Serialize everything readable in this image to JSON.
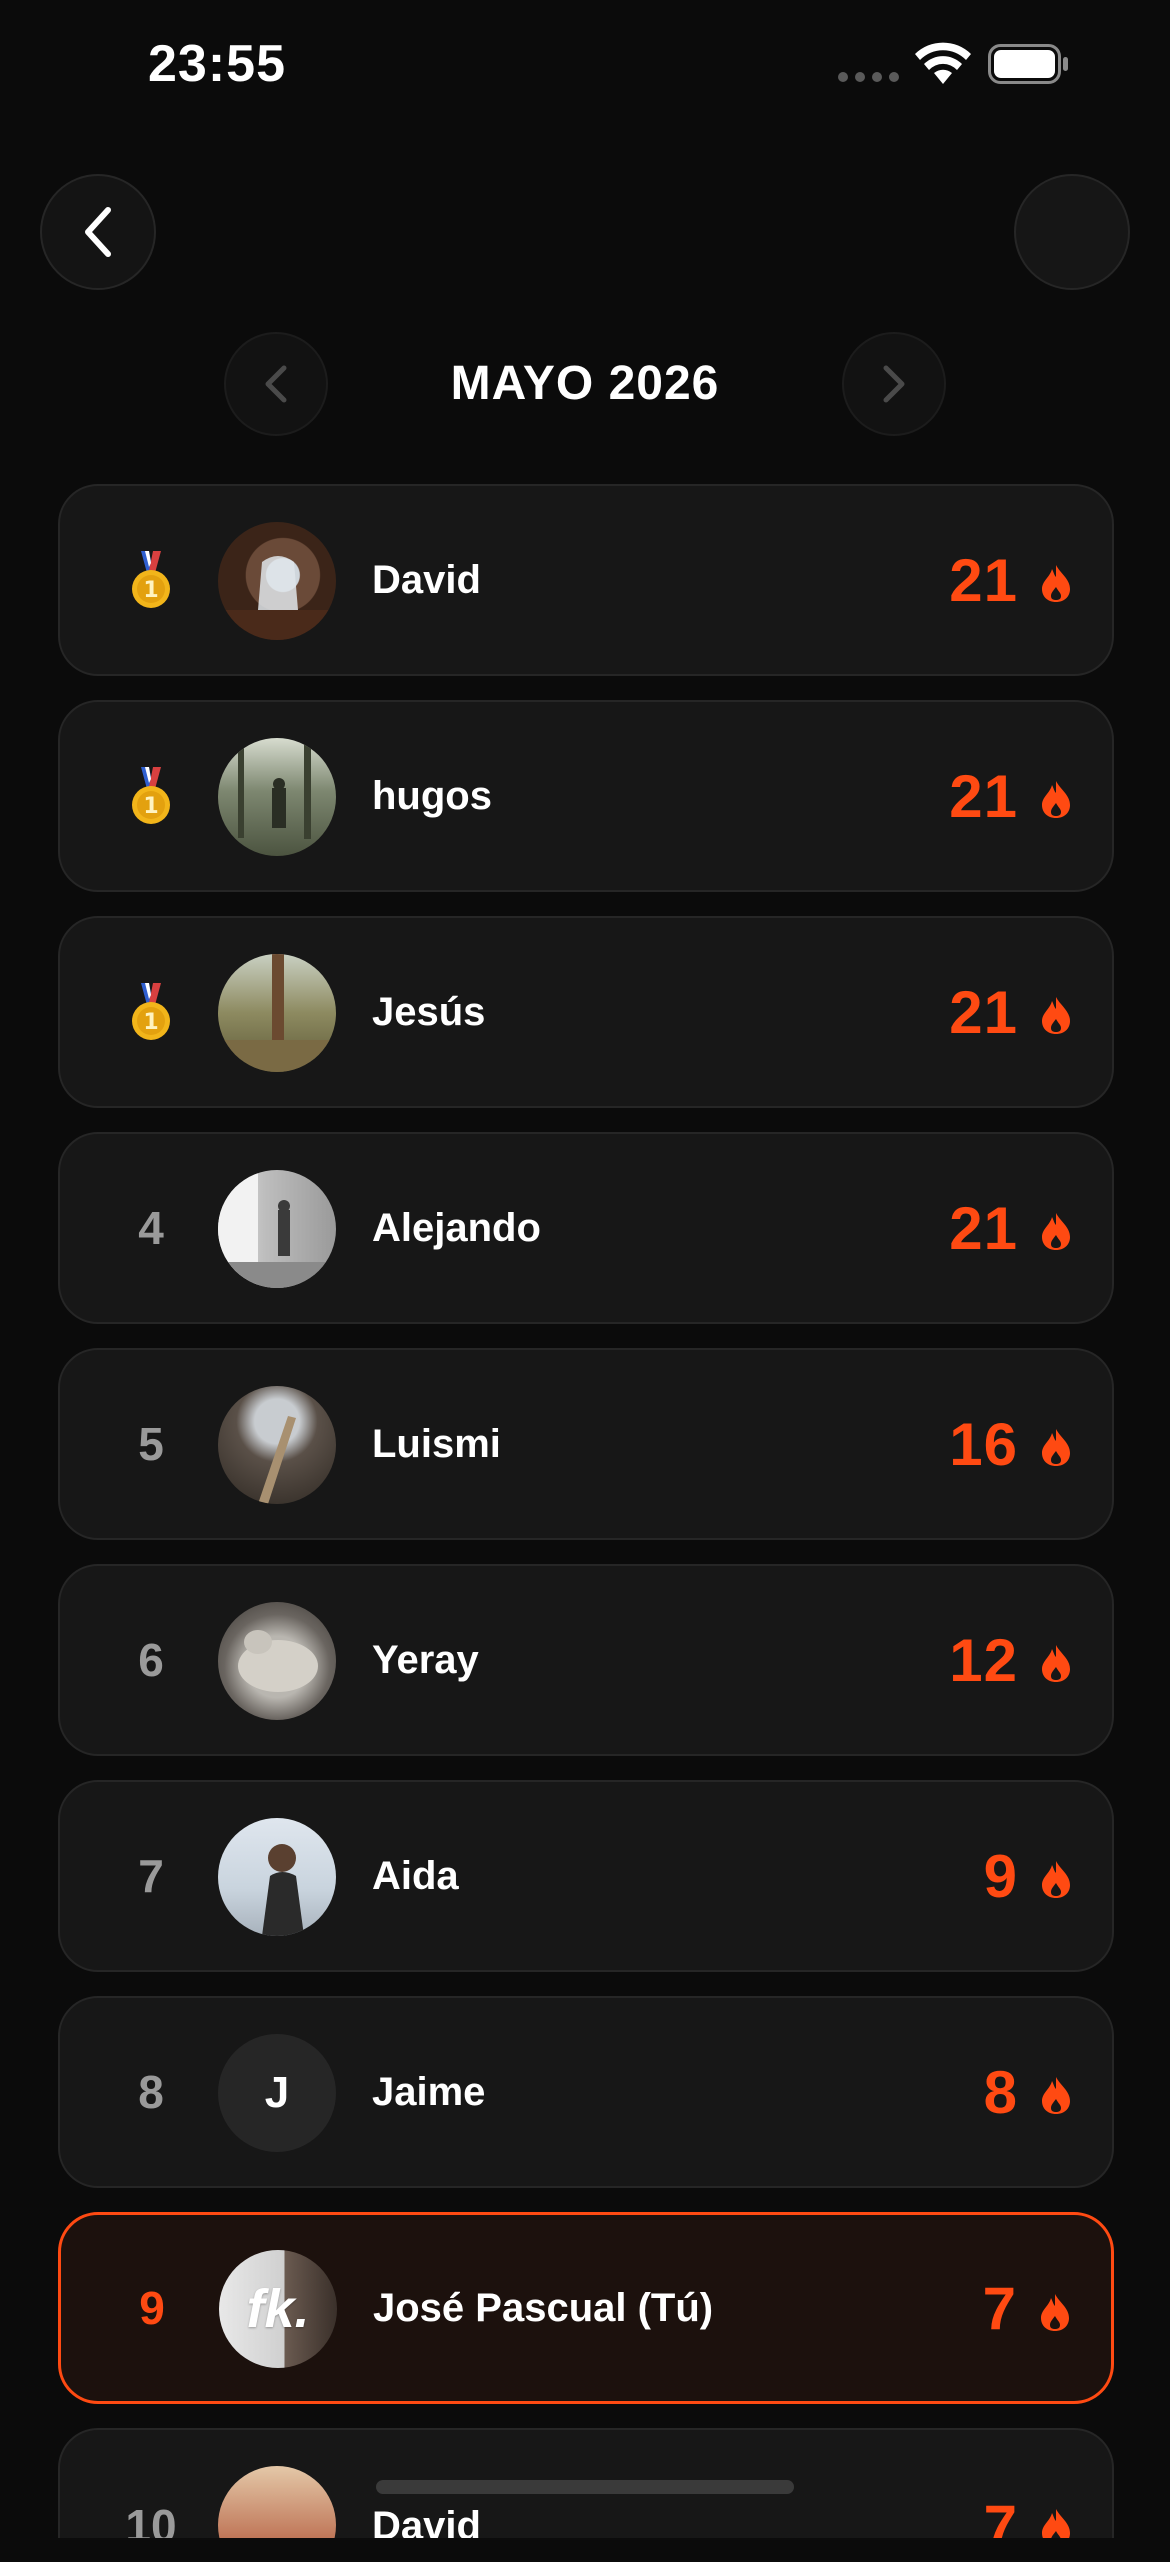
{
  "status_bar": {
    "time": "23:55"
  },
  "header": {
    "month_title": "MAYO 2026"
  },
  "colors": {
    "accent": "#ff4a12",
    "background": "#0b0b0b",
    "card": "#171717",
    "rank_text": "#9a9a9a"
  },
  "leaderboard": [
    {
      "rank": "1",
      "medal": "gold-medal-icon",
      "name": "David",
      "score": "21"
    },
    {
      "rank": "1",
      "medal": "gold-medal-icon",
      "name": "hugos",
      "score": "21"
    },
    {
      "rank": "1",
      "medal": "gold-medal-icon",
      "name": "Jesús",
      "score": "21"
    },
    {
      "rank": "4",
      "name": "Alejando",
      "score": "21"
    },
    {
      "rank": "5",
      "name": "Luismi",
      "score": "16"
    },
    {
      "rank": "6",
      "name": "Yeray",
      "score": "12"
    },
    {
      "rank": "7",
      "name": "Aida",
      "score": "9"
    },
    {
      "rank": "8",
      "name": "Jaime",
      "avatar_initial": "J",
      "score": "8"
    },
    {
      "rank": "9",
      "name": "José Pascual (Tú)",
      "avatar_text": "fk.",
      "score": "7",
      "is_current_user": true
    },
    {
      "rank": "10",
      "name": "David",
      "score": "7"
    }
  ]
}
